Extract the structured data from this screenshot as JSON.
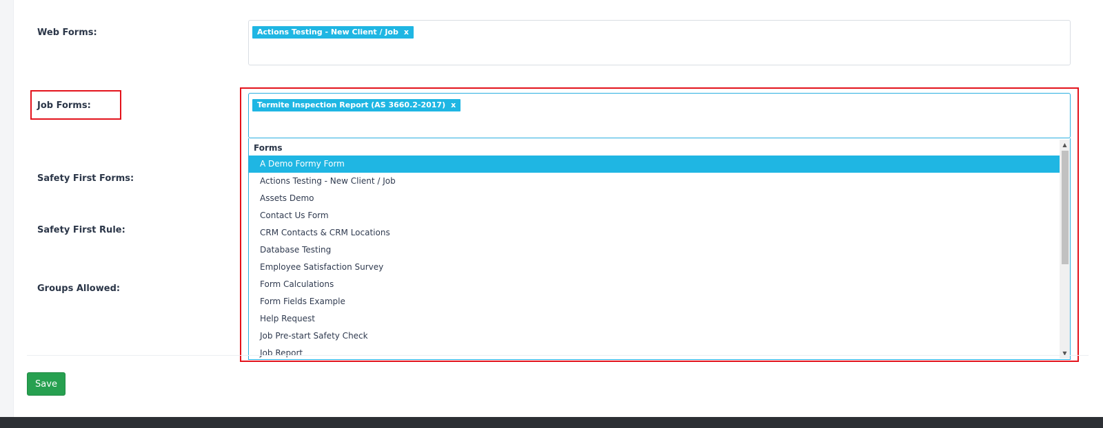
{
  "fields": {
    "web_forms": {
      "label": "Web Forms:",
      "tags": [
        {
          "label": "Actions Testing - New Client / Job",
          "remove": "x"
        }
      ]
    },
    "job_forms": {
      "label": "Job Forms:",
      "tags": [
        {
          "label": "Termite Inspection Report (AS 3660.2-2017)",
          "remove": "x"
        }
      ]
    },
    "safety_first_forms": {
      "label": "Safety First Forms:"
    },
    "safety_first_rule": {
      "label": "Safety First Rule:"
    },
    "groups_allowed": {
      "label": "Groups Allowed:"
    }
  },
  "dropdown": {
    "group_label": "Forms",
    "active_index": 0,
    "items": [
      "A Demo Formy Form",
      "Actions Testing - New Client / Job",
      "Assets Demo",
      "Contact Us Form",
      "CRM Contacts & CRM Locations",
      "Database Testing",
      "Employee Satisfaction Survey",
      "Form Calculations",
      "Form Fields Example",
      "Help Request",
      "Job Pre-start Safety Check",
      "Job Report"
    ],
    "scroll_up": "▲",
    "scroll_down": "▼"
  },
  "actions": {
    "save_label": "Save"
  },
  "colors": {
    "accent": "#1fb6e3",
    "highlight": "#e3121b",
    "save_button": "#27a050"
  }
}
